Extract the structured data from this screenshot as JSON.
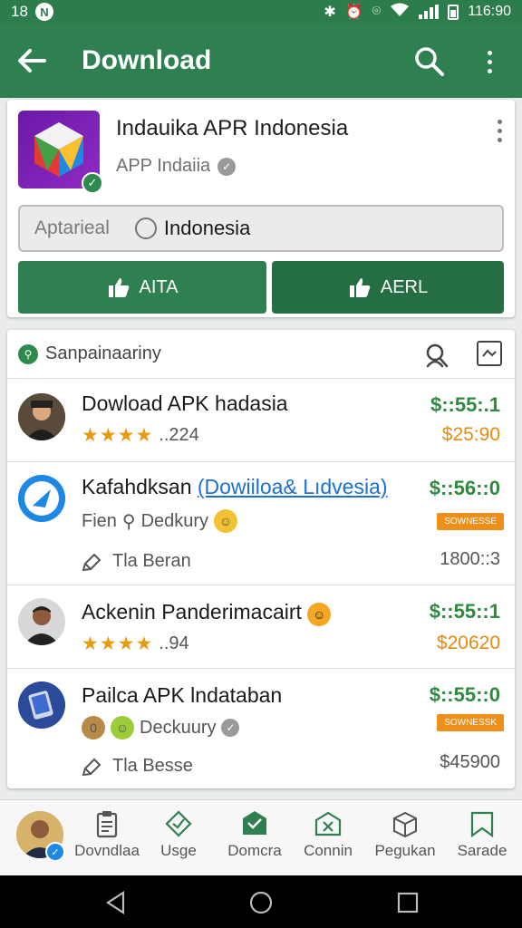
{
  "status_bar": {
    "left_number": "18",
    "notification_letter": "N",
    "time": "116:90"
  },
  "app_bar": {
    "title": "Download"
  },
  "top_card": {
    "app_name": "Indauika APR Indonesia",
    "app_subtitle": "APP Indaiia",
    "language_placeholder": "Aptarieal",
    "language_value": "Indonesia",
    "button_left": "AITA",
    "button_right": "AERL"
  },
  "list": {
    "header_title": "Sanpainaariny",
    "items": [
      {
        "title": "Dowload APK hadasia",
        "stars": "★★★★",
        "rating": "..224",
        "price_top": "$::55:.1",
        "price_bottom": "$25:90"
      },
      {
        "title": "Kafahdksan",
        "title_link": "(Dowiiloa& Lıdvesia)",
        "sub_a": "Fien",
        "sub_b": "Dedkury",
        "price_top": "$::56::0",
        "badge": "SOWNESSE",
        "foot_left": "Tla Beran",
        "foot_right": "1800::3"
      },
      {
        "title": "Ackenin Panderimacairt",
        "stars": "★★★★",
        "rating": "..94",
        "price_top": "$::55::1",
        "price_bottom": "$20620"
      },
      {
        "title": "Pailca APK lndataban",
        "sub_b": "Deckuury",
        "price_top": "$::55::0",
        "badge": "SOWNESSK",
        "foot_left": "Tla Besse",
        "foot_right": "$45900"
      }
    ]
  },
  "bottom_nav": {
    "items": [
      {
        "label": "Dovndlaa"
      },
      {
        "label": "Usge"
      },
      {
        "label": "Domcra"
      },
      {
        "label": "Connin"
      },
      {
        "label": "Pegukan"
      },
      {
        "label": "Sarade"
      }
    ]
  },
  "colors": {
    "primary": "#2e8050",
    "price_green": "#2e8b3e",
    "price_orange": "#e58a12",
    "link_blue": "#1c6fd6"
  }
}
